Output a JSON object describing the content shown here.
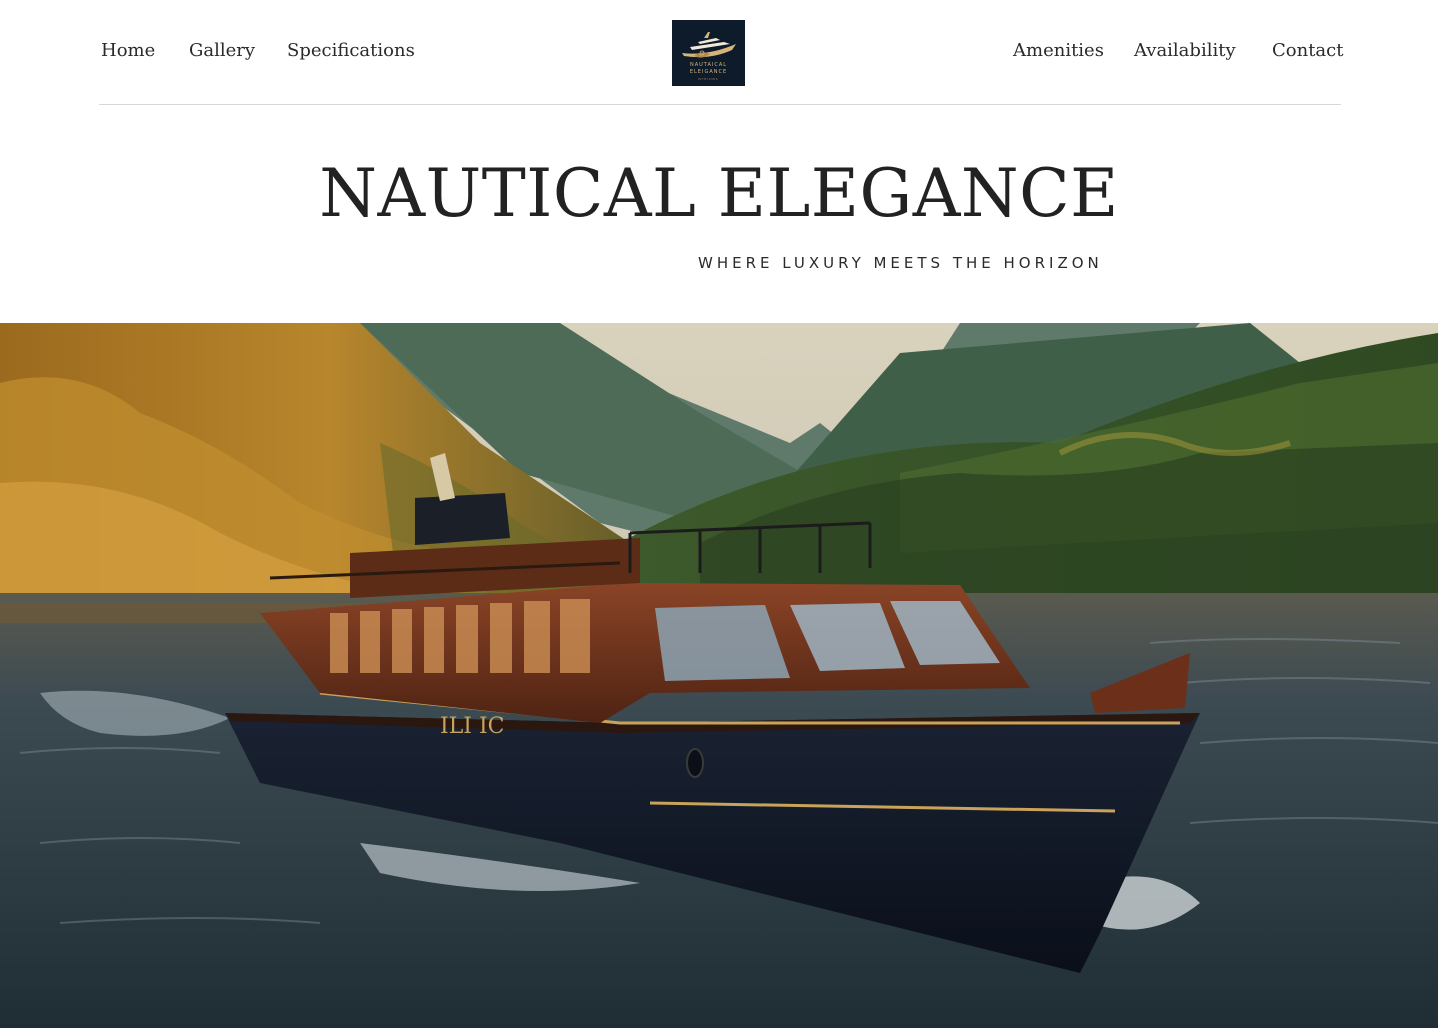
{
  "nav": {
    "left_links": [
      "Home",
      "Gallery",
      "Specifications"
    ],
    "right_links": [
      "Amenities",
      "Availability",
      "Contact"
    ],
    "logo": {
      "line1": "NAUTAICAL",
      "line2": "ELEIGANCE",
      "line3": "NTEIONS"
    }
  },
  "hero": {
    "title": "NAUTICAL ELEGANCE",
    "subtitle": "WHERE LUXURY MEETS THE HORIZON",
    "image_icon": "yacht-river-photo",
    "boat_name": "ILI IC"
  },
  "colors": {
    "logo_bg": "#0e1b2b",
    "logo_gold": "#d6b578",
    "hull": "#0f1624",
    "wood": "#6b2f1a",
    "water": "#2b3a44"
  }
}
